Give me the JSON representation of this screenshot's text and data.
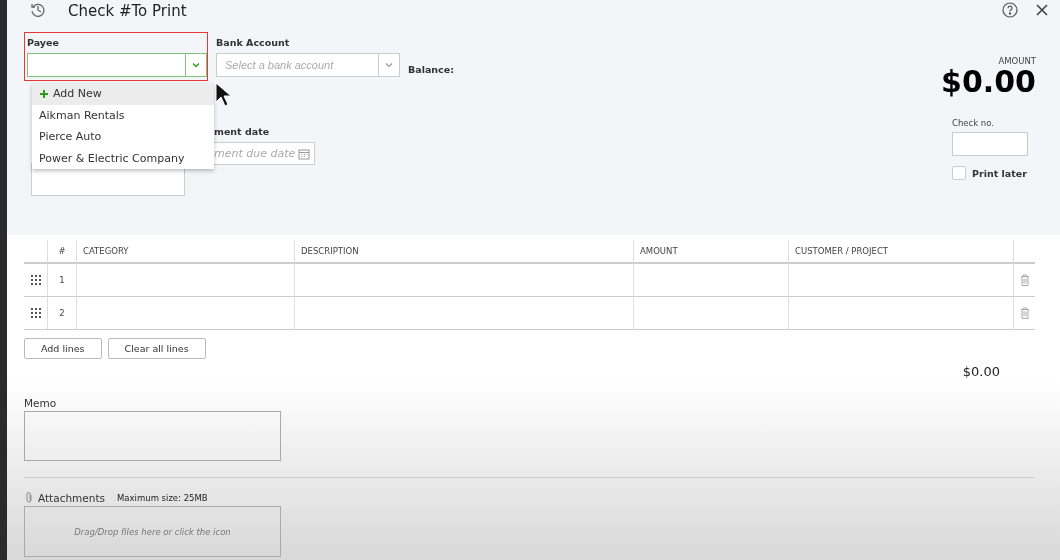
{
  "window": {
    "title": "Check #To Print"
  },
  "payee": {
    "label": "Payee",
    "highlighted": true,
    "open": true
  },
  "payee_menu": [
    {
      "kind": "add",
      "label": "Add New",
      "selected": true
    },
    {
      "kind": "option",
      "label": "Aikman Rentals",
      "selected": false
    },
    {
      "kind": "option",
      "label": "Pierce Auto",
      "selected": false
    },
    {
      "kind": "option",
      "label": "Power & Electric Company",
      "selected": false
    }
  ],
  "bank_account": {
    "label": "Bank Account",
    "placeholder": "Select a bank account"
  },
  "balance": {
    "label": "Balance:"
  },
  "amount": {
    "label": "AMOUNT",
    "value": "$0.00"
  },
  "payment_date": {
    "label": "ment date",
    "placeholder": "ment due date"
  },
  "check_no": {
    "label": "Check no."
  },
  "print_later": {
    "label": "Print later",
    "checked": false
  },
  "table": {
    "columns": [
      "#",
      "CATEGORY",
      "DESCRIPTION",
      "AMOUNT",
      "CUSTOMER / PROJECT"
    ],
    "rows": [
      {
        "number": "1"
      },
      {
        "number": "2"
      }
    ]
  },
  "buttons": [
    "Add lines",
    "Clear all lines"
  ],
  "total": "$0.00",
  "memo": {
    "label": "Memo"
  },
  "attachments": {
    "label": "Attachments",
    "max_size": "Maximum size: 25MB",
    "placeholder": "Drag/Drop files here or click the icon"
  }
}
